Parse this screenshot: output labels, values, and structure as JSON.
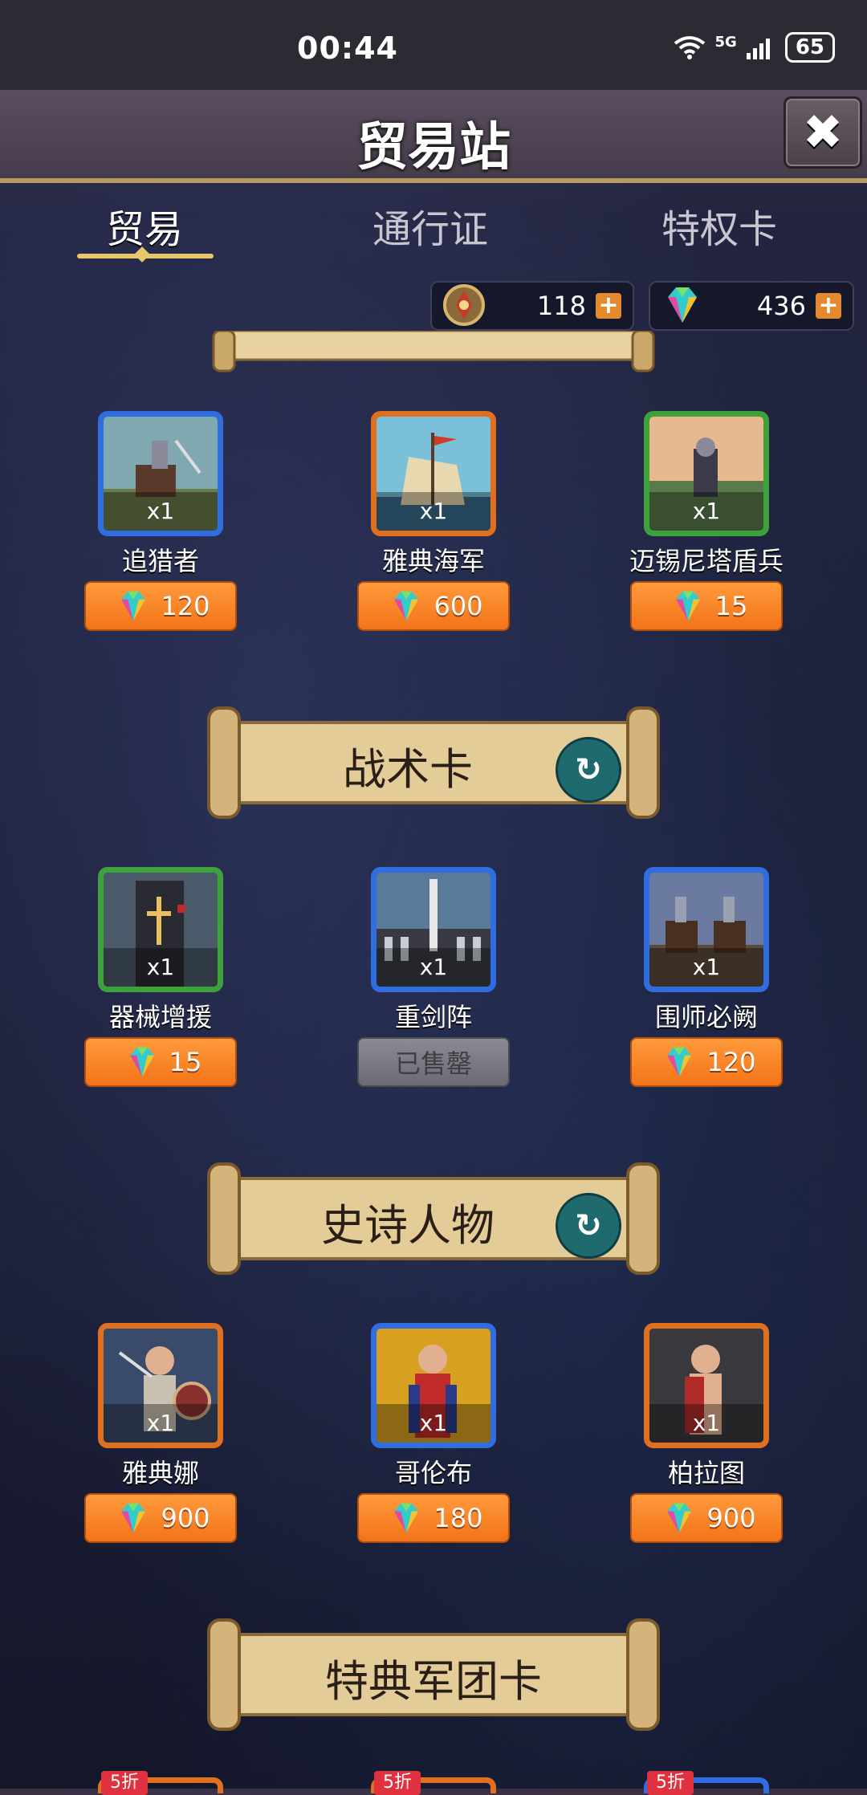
{
  "status": {
    "time": "00:44",
    "network": "5G",
    "battery": "65"
  },
  "header": {
    "title": "贸易站",
    "close_label": "✖"
  },
  "tabs": [
    {
      "label": "贸易"
    },
    {
      "label": "通行证"
    },
    {
      "label": "特权卡"
    }
  ],
  "currency": {
    "medal": "118",
    "gems": "436",
    "plus": "+"
  },
  "sections": {
    "tactics": {
      "title": "战术卡",
      "refresh": "↻"
    },
    "epic": {
      "title": "史诗人物",
      "refresh": "↻"
    },
    "legion": {
      "title": "特典军团卡"
    }
  },
  "row1": [
    {
      "name": "追猎者",
      "qty": "x1",
      "price": "120",
      "rarity": "blue"
    },
    {
      "name": "雅典海军",
      "qty": "x1",
      "price": "600",
      "rarity": "orange"
    },
    {
      "name": "迈锡尼塔盾兵",
      "qty": "x1",
      "price": "15",
      "rarity": "green"
    }
  ],
  "row2": [
    {
      "name": "器械增援",
      "qty": "x1",
      "price": "15",
      "rarity": "green"
    },
    {
      "name": "重剑阵",
      "qty": "x1",
      "price": "已售罄",
      "rarity": "blue"
    },
    {
      "name": "围师必阙",
      "qty": "x1",
      "price": "120",
      "rarity": "blue"
    }
  ],
  "row3": [
    {
      "name": "雅典娜",
      "qty": "x1",
      "price": "900",
      "rarity": "orange"
    },
    {
      "name": "哥伦布",
      "qty": "x1",
      "price": "180",
      "rarity": "blue"
    },
    {
      "name": "柏拉图",
      "qty": "x1",
      "price": "900",
      "rarity": "orange"
    }
  ],
  "bottom_badges": [
    "5折",
    "5折",
    "5折"
  ],
  "colors": {
    "accent": "#e8c66a",
    "price_bg": "#f27418",
    "teal": "#1f6a6e"
  }
}
